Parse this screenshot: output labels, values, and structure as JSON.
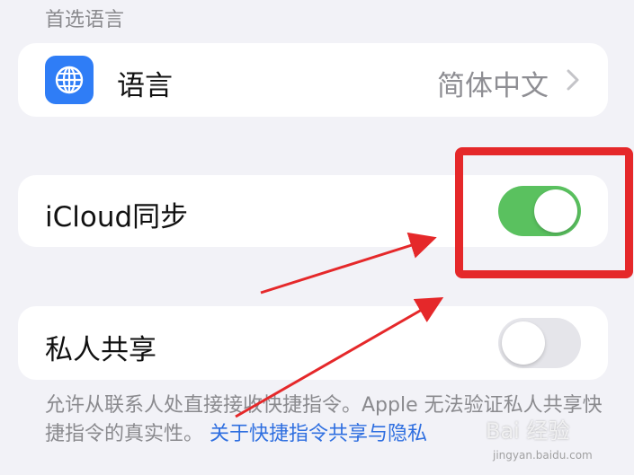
{
  "section_header": "首选语言",
  "language_row": {
    "icon": "globe-icon",
    "label": "语言",
    "value": "简体中文",
    "chevron": "chevron-right-icon"
  },
  "icloud_row": {
    "label": "iCloud同步",
    "toggle_on": true
  },
  "private_sharing_row": {
    "label": "私人共享",
    "toggle_on": false
  },
  "footer": {
    "text": "允许从联系人处直接接收快捷指令。Apple 无法验证私人共享快捷指令的真实性。",
    "link": "关于快捷指令共享与隐私"
  },
  "watermark": {
    "text": "Bai 经验",
    "sub": "jingyan.baidu.com"
  },
  "colors": {
    "background": "#f2f2f7",
    "toggle_on": "#5ac15f",
    "toggle_off": "#e5e5ea",
    "accent_link": "#2f6fe0",
    "annotation_red": "#e5282a",
    "globe_tile": "#2f7df6"
  }
}
